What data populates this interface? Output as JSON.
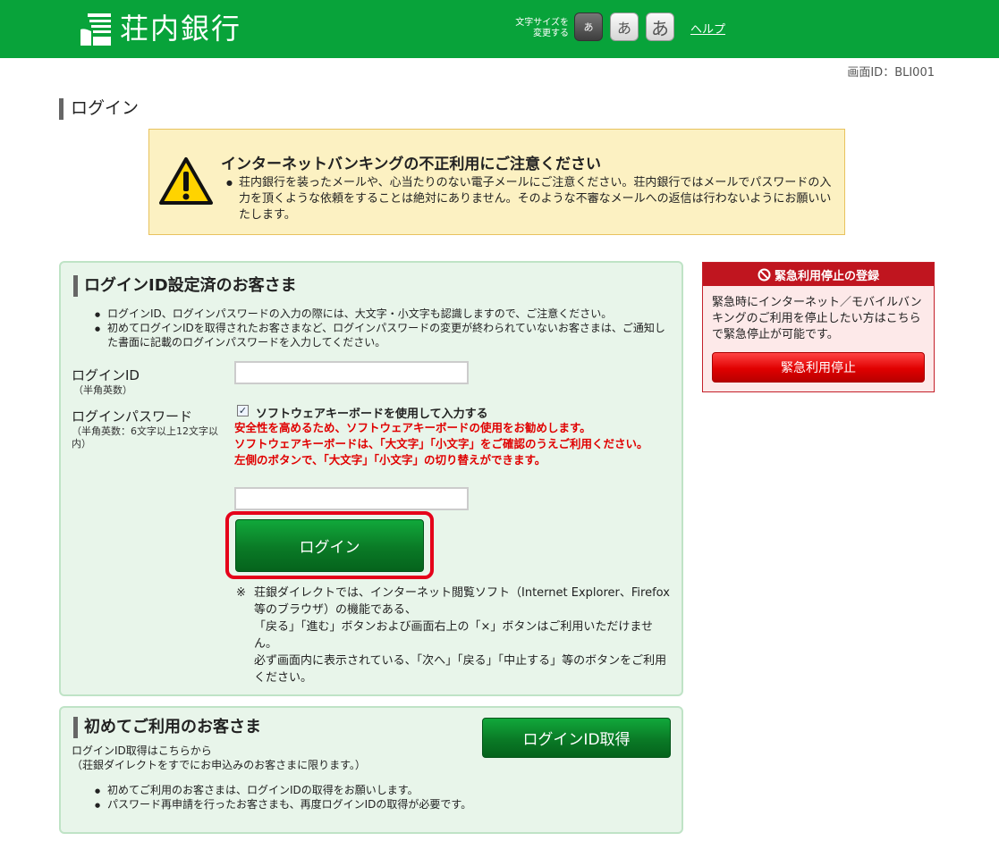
{
  "header": {
    "bank_name": "荘内銀行",
    "font_size_label_line1": "文字サイズを",
    "font_size_label_line2": "変更する",
    "font_size_small": "あ",
    "font_size_medium": "あ",
    "font_size_large": "あ",
    "help_link": "ヘルプ",
    "brand_color": "#08a33a"
  },
  "screen_id": "画面ID：BLI001",
  "page_title": "ログイン",
  "warning": {
    "icon": "warning-icon",
    "title": "インターネットバンキングの不正利用にご注意ください",
    "body": "荘内銀行を装ったメールや、心当たりのない電子メールにご注意ください。荘内銀行ではメールでパスワードの入力を頂くような依頼をすることは絶対にありません。そのような不審なメールへの返信は行わないようにお願いいたします。"
  },
  "login_section": {
    "title": "ログインID設定済のお客さま",
    "bullets": [
      "ログインID、ログインパスワードの入力の際には、大文字・小文字も認識しますので、ご注意ください。",
      "初めてログインIDを取得されたお客さまなど、ログインパスワードの変更が終わられていないお客さまは、ご通知した書面に記載のログインパスワードを入力してください。"
    ],
    "login_id_label": "ログインID",
    "login_id_sub": "（半角英数）",
    "login_id_value": "",
    "password_label": "ログインパスワード",
    "password_sub": "（半角英数：6文字以上12文字以内）",
    "software_keyboard_checked": true,
    "software_keyboard_label": "ソフトウェアキーボードを使用して入力する",
    "red_notes": [
      "安全性を高めるため、ソフトウェアキーボードの使用をお勧めします。",
      "ソフトウェアキーボードは、「大文字」「小文字」をご確認のうえご利用ください。",
      "左側のボタンで、「大文字」「小文字」の切り替えができます。"
    ],
    "password_value": "",
    "login_button": "ログイン",
    "note_mark": "※",
    "note_lines": [
      "荘銀ダイレクトでは、インターネット閲覧ソフト（Internet Explorer、Firefox等のブラウザ）の機能である、",
      "「戻る」「進む」ボタンおよび画面右上の「×」ボタンはご利用いただけません。",
      "必ず画面内に表示されている、「次へ」「戻る」「中止する」等のボタンをご利用ください。"
    ]
  },
  "first_section": {
    "title": "初めてご利用のお客さま",
    "desc_line1": "ログインID取得はこちらから",
    "desc_line2": "（荘銀ダイレクトをすでにお申込みのお客さまに限ります。）",
    "get_id_button": "ログインID取得",
    "bullets": [
      "初めてご利用のお客さまは、ログインIDの取得をお願いします。",
      "パスワード再申請を行ったお客さまも、再度ログインIDの取得が必要です。"
    ]
  },
  "emergency": {
    "icon": "prohibited-icon",
    "title": "緊急利用停止の登録",
    "text": "緊急時にインターネット／モバイルバンキングのご利用を停止したい方はこちらで緊急停止が可能です。",
    "button": "緊急利用停止",
    "accent_color": "#c0151f"
  }
}
